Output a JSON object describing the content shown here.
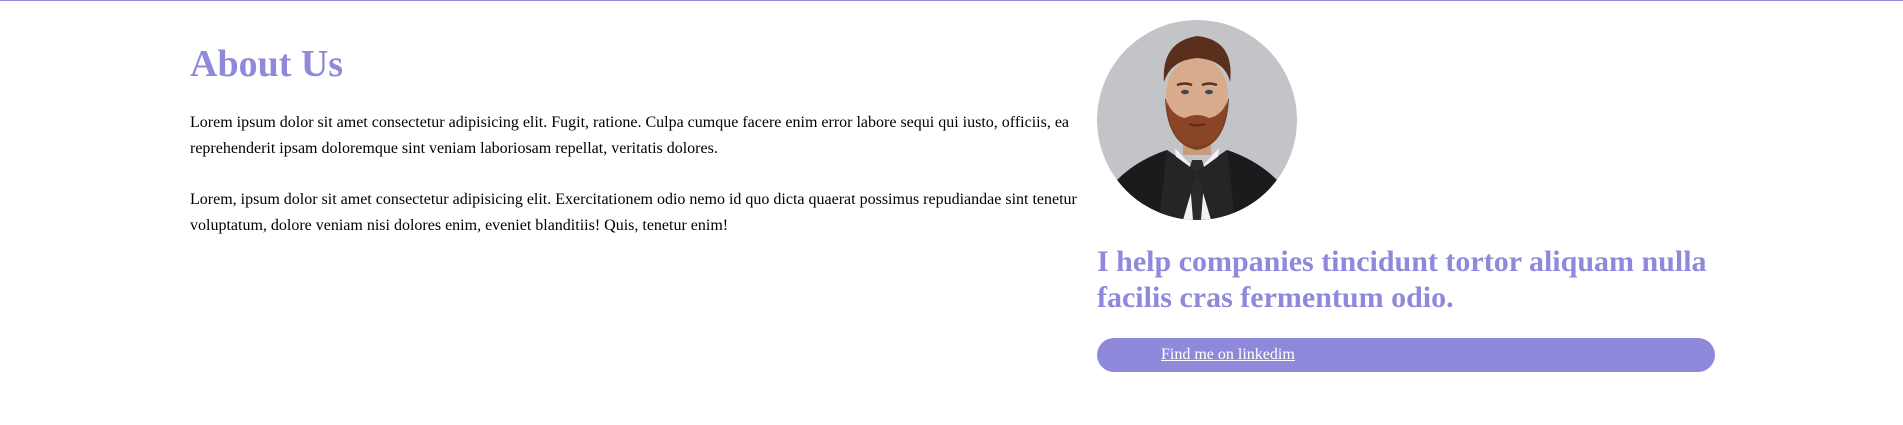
{
  "about": {
    "heading": "About Us",
    "paragraphs": [
      "Lorem ipsum dolor sit amet consectetur adipisicing elit. Fugit, ratione. Culpa cumque facere enim error labore sequi qui iusto, officiis, ea reprehenderit ipsam doloremque sint veniam laboriosam repellat, veritatis dolores.",
      "Lorem, ipsum dolor sit amet consectetur adipisicing elit. Exercitationem odio nemo id quo dicta quaerat possimus repudiandae sint tenetur voluptatum, dolore veniam nisi dolores enim, eveniet blanditiis! Quis, tenetur enim!"
    ]
  },
  "profile": {
    "tagline": "I help companies tincidunt tortor aliquam nulla facilis cras fermentum odio.",
    "linkedin_label": "Find me on linkedim"
  },
  "colors": {
    "accent": "#8f89dc",
    "text": "#000000",
    "background": "#ffffff"
  }
}
